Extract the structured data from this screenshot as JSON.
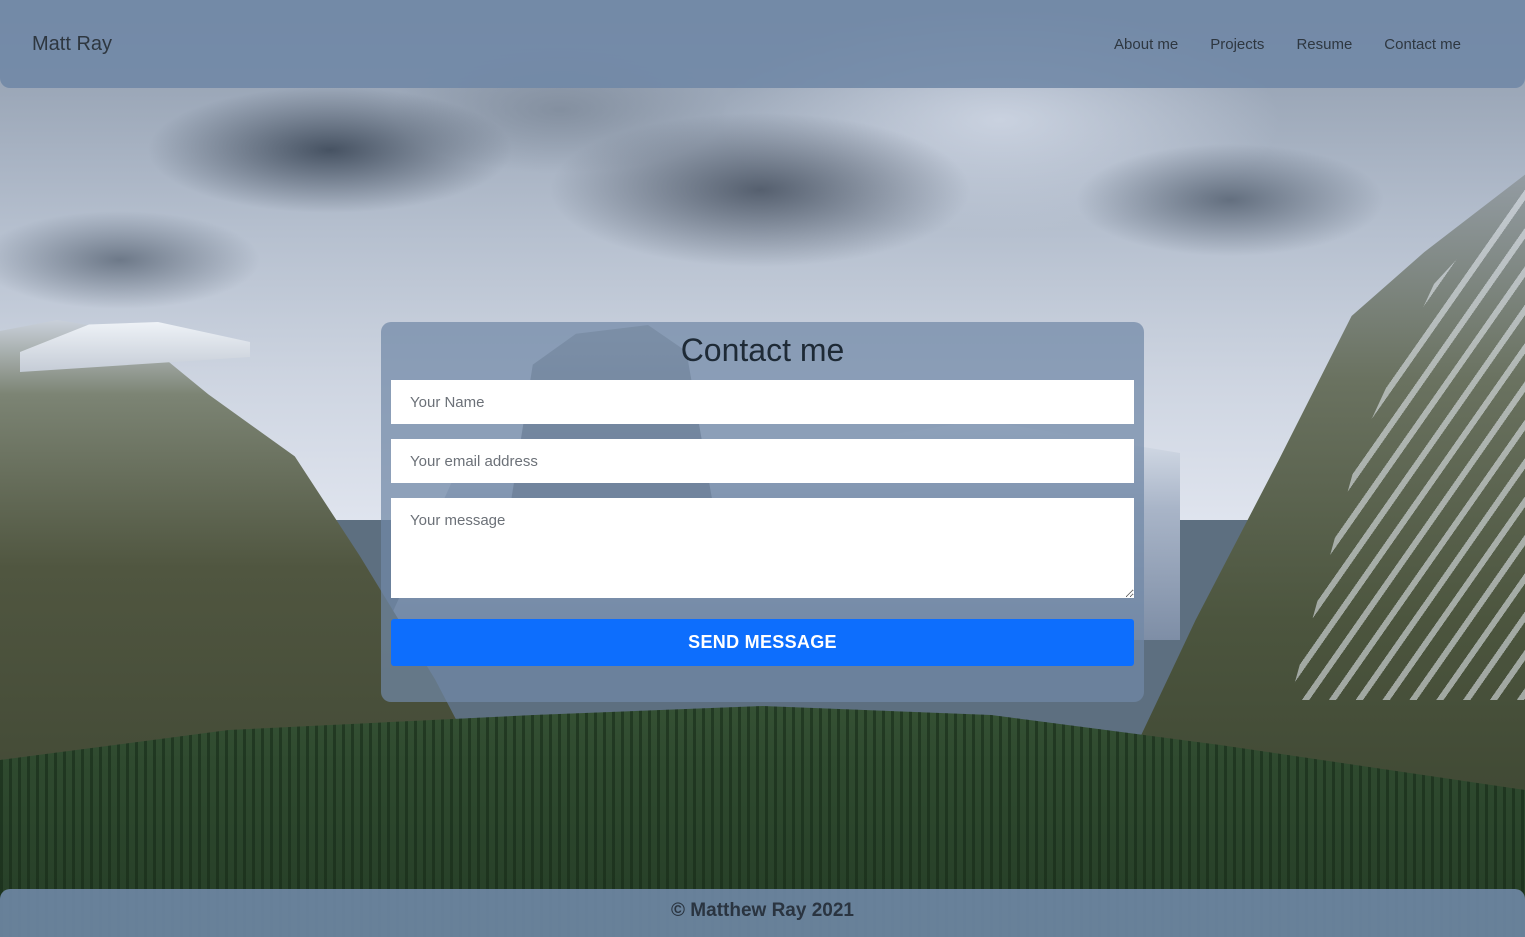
{
  "navbar": {
    "brand": "Matt Ray",
    "links": [
      "About me",
      "Projects",
      "Resume",
      "Contact me"
    ]
  },
  "contact": {
    "title": "Contact me",
    "name_placeholder": "Your Name",
    "email_placeholder": "Your email address",
    "message_placeholder": "Your message",
    "send_label": "SEND MESSAGE"
  },
  "footer": {
    "text": "© Matthew Ray 2021"
  },
  "colors": {
    "accent": "#0d6efd",
    "overlay": "#7088a6"
  }
}
